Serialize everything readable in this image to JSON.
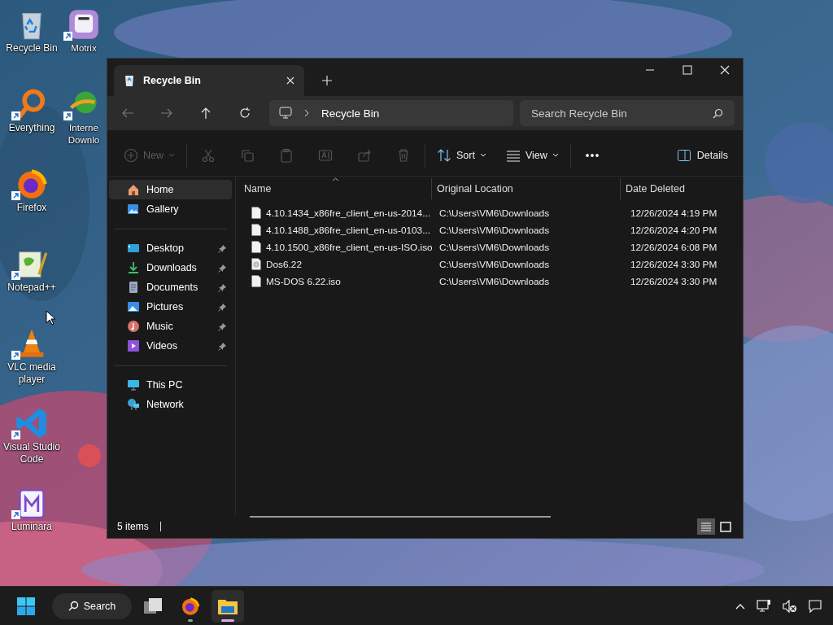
{
  "desktop": {
    "columns": [
      [
        {
          "label": "Recycle Bin",
          "kind": "recycle",
          "shortcut": false
        },
        {
          "label": "Everything",
          "kind": "everything",
          "shortcut": true
        },
        {
          "label": "Firefox",
          "kind": "firefox",
          "shortcut": true
        },
        {
          "label": "Notepad++",
          "kind": "notepad",
          "shortcut": true
        },
        {
          "label": "VLC media player",
          "kind": "vlc",
          "shortcut": true
        },
        {
          "label": "Visual Studio Code",
          "kind": "vscode",
          "shortcut": true
        },
        {
          "label": "Luminara",
          "kind": "luminara",
          "shortcut": true
        }
      ],
      [
        {
          "label": "Motrix",
          "kind": "motrix",
          "shortcut": true
        },
        {
          "label": "Interne Downlo",
          "kind": "idm",
          "shortcut": true
        }
      ]
    ]
  },
  "window": {
    "tabs": [
      {
        "title": "Recycle Bin",
        "selected": true
      }
    ],
    "address": {
      "crumbs": [
        "Recycle Bin"
      ]
    },
    "search": {
      "placeholder": "Search Recycle Bin"
    },
    "toolbar": {
      "groups": [
        [
          {
            "kind": "new",
            "label": "New",
            "disabled": true
          }
        ],
        [
          {
            "kind": "cut",
            "disabled": true
          },
          {
            "kind": "copy",
            "disabled": true
          },
          {
            "kind": "paste",
            "disabled": true
          },
          {
            "kind": "rename",
            "disabled": true
          },
          {
            "kind": "share",
            "disabled": true
          },
          {
            "kind": "delete",
            "disabled": true
          }
        ],
        [
          {
            "kind": "sort",
            "label": "Sort",
            "disabled": false
          },
          {
            "kind": "view",
            "label": "View",
            "disabled": false
          }
        ],
        [
          {
            "kind": "more",
            "disabled": false
          }
        ]
      ],
      "details": {
        "label": "Details"
      }
    },
    "sidebar": {
      "groups": [
        [
          {
            "label": "Home",
            "kind": "home",
            "selected": true,
            "pinned": false
          },
          {
            "label": "Gallery",
            "kind": "gallery",
            "selected": false,
            "pinned": false
          }
        ],
        [
          {
            "label": "Desktop",
            "kind": "desktop",
            "selected": false,
            "pinned": true
          },
          {
            "label": "Downloads",
            "kind": "downloads",
            "selected": false,
            "pinned": true
          },
          {
            "label": "Documents",
            "kind": "documents",
            "selected": false,
            "pinned": true
          },
          {
            "label": "Pictures",
            "kind": "pictures",
            "selected": false,
            "pinned": true
          },
          {
            "label": "Music",
            "kind": "music",
            "selected": false,
            "pinned": true
          },
          {
            "label": "Videos",
            "kind": "videos",
            "selected": false,
            "pinned": true
          }
        ],
        [
          {
            "label": "This PC",
            "kind": "pc",
            "selected": false,
            "pinned": false
          },
          {
            "label": "Network",
            "kind": "network",
            "selected": false,
            "pinned": false
          }
        ]
      ]
    },
    "table": {
      "columns": [
        {
          "label": "Name",
          "sorted": true
        },
        {
          "label": "Original Location",
          "sorted": false
        },
        {
          "label": "Date Deleted",
          "sorted": false
        }
      ],
      "rows": [
        {
          "kind": "file",
          "name": "4.10.1434_x86fre_client_en-us-2014...",
          "location": "C:\\Users\\VM6\\Downloads",
          "date": "12/26/2024 4:19 PM"
        },
        {
          "kind": "file",
          "name": "4.10.1488_x86fre_client_en-us-0103...",
          "location": "C:\\Users\\VM6\\Downloads",
          "date": "12/26/2024 4:20 PM"
        },
        {
          "kind": "file",
          "name": "4.10.1500_x86fre_client_en-us-ISO.iso",
          "location": "C:\\Users\\VM6\\Downloads",
          "date": "12/26/2024 6:08 PM"
        },
        {
          "kind": "disc",
          "name": "Dos6.22",
          "location": "C:\\Users\\VM6\\Downloads",
          "date": "12/26/2024 3:30 PM"
        },
        {
          "kind": "file",
          "name": "MS-DOS 6.22.iso",
          "location": "C:\\Users\\VM6\\Downloads",
          "date": "12/26/2024 3:30 PM"
        }
      ]
    },
    "status_bar": {
      "count": "5 items",
      "views": [
        {
          "kind": "details",
          "selected": true
        },
        {
          "kind": "tiles",
          "selected": false
        }
      ]
    }
  },
  "taskbar": {
    "search": "Search",
    "apps": [
      {
        "kind": "taskview",
        "running": false,
        "selected": false
      },
      {
        "kind": "firefox",
        "running": true,
        "selected": false
      },
      {
        "kind": "explorer",
        "running": true,
        "selected": true
      }
    ],
    "tray": [
      {
        "kind": "chevron"
      },
      {
        "kind": "network"
      },
      {
        "kind": "volume"
      },
      {
        "kind": "notifications"
      }
    ]
  }
}
